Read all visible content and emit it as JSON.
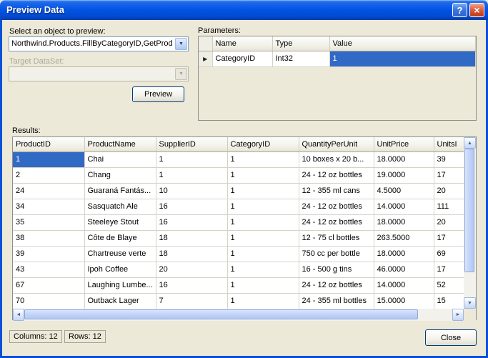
{
  "window": {
    "title": "Preview Data"
  },
  "icons": {
    "help": "?",
    "close": "×",
    "dropdown": "▼",
    "row_indicator": "▶",
    "up": "▲",
    "down": "▼",
    "left": "◄",
    "right": "►"
  },
  "colors": {
    "selection": "#316AC5",
    "titlebar": "#0054E3",
    "dialog_bg": "#ECE9D8"
  },
  "object_picker": {
    "label": "Select an object to preview:",
    "value": "Northwind.Products.FillByCategoryID,GetProd"
  },
  "target_dataset": {
    "label": "Target DataSet:",
    "value": ""
  },
  "preview_button": "Preview",
  "parameters": {
    "label": "Parameters:",
    "headers": [
      "Name",
      "Type",
      "Value"
    ],
    "rows": [
      {
        "name": "CategoryID",
        "type": "Int32",
        "value": "1"
      }
    ]
  },
  "results": {
    "label": "Results:",
    "headers": [
      "ProductID",
      "ProductName",
      "SupplierID",
      "CategoryID",
      "QuantityPerUnit",
      "UnitPrice",
      "UnitsI"
    ],
    "rows": [
      [
        "1",
        "Chai",
        "1",
        "1",
        "10 boxes x 20 b...",
        "18.0000",
        "39"
      ],
      [
        "2",
        "Chang",
        "1",
        "1",
        "24 - 12 oz bottles",
        "19.0000",
        "17"
      ],
      [
        "24",
        "Guaraná Fantás...",
        "10",
        "1",
        "12 - 355 ml cans",
        "4.5000",
        "20"
      ],
      [
        "34",
        "Sasquatch Ale",
        "16",
        "1",
        "24 - 12 oz bottles",
        "14.0000",
        "111"
      ],
      [
        "35",
        "Steeleye Stout",
        "16",
        "1",
        "24 - 12 oz bottles",
        "18.0000",
        "20"
      ],
      [
        "38",
        "Côte de Blaye",
        "18",
        "1",
        "12 - 75 cl bottles",
        "263.5000",
        "17"
      ],
      [
        "39",
        "Chartreuse verte",
        "18",
        "1",
        "750 cc per bottle",
        "18.0000",
        "69"
      ],
      [
        "43",
        "Ipoh Coffee",
        "20",
        "1",
        "16 - 500 g tins",
        "46.0000",
        "17"
      ],
      [
        "67",
        "Laughing Lumbe...",
        "16",
        "1",
        "24 - 12 oz bottles",
        "14.0000",
        "52"
      ],
      [
        "70",
        "Outback Lager",
        "7",
        "1",
        "24 - 355 ml bottles",
        "15.0000",
        "15"
      ]
    ],
    "selected_cell": {
      "row": 0,
      "col": 0
    }
  },
  "status": {
    "columns": "Columns: 12",
    "rows": "Rows: 12"
  },
  "close_button": "Close"
}
